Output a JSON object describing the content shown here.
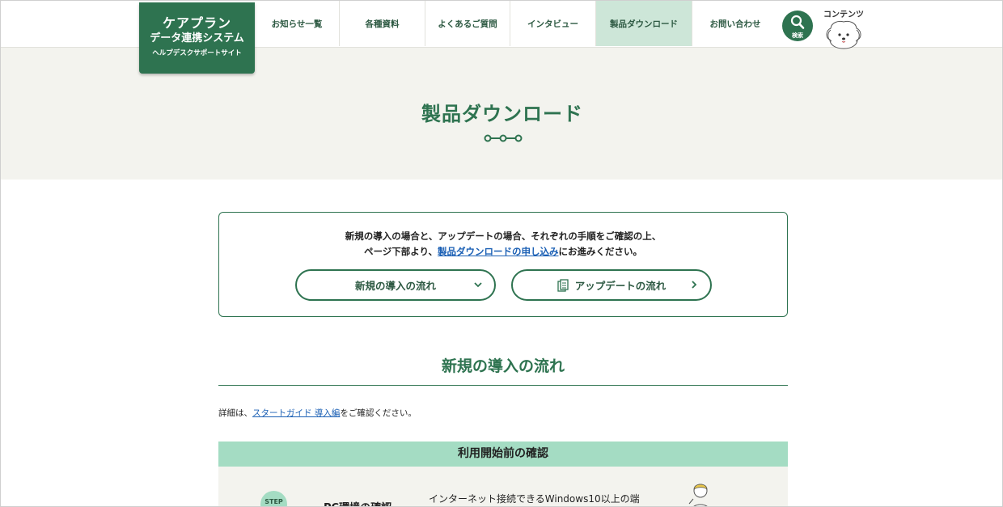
{
  "logo": {
    "line1": "ケアプラン",
    "line2": "データ連携システム",
    "line3": "ヘルプデスクサポートサイト"
  },
  "nav": [
    {
      "label": "お知らせ一覧",
      "active": false
    },
    {
      "label": "各種資料",
      "active": false
    },
    {
      "label": "よくあるご質問",
      "active": false
    },
    {
      "label": "インタビュー",
      "active": false
    },
    {
      "label": "製品ダウンロード",
      "active": true
    },
    {
      "label": "お問い合わせ",
      "active": false
    }
  ],
  "search": {
    "label": "検索"
  },
  "contents": {
    "label": "コンテンツ"
  },
  "hero": {
    "title": "製品ダウンロード"
  },
  "info": {
    "line1": "新規の導入の場合と、アップデートの場合、それぞれの手順をご確認の上、",
    "line2_prefix": "ページ下部より、",
    "line2_link": "製品ダウンロードの申し込み",
    "line2_suffix": "にお進みください。",
    "button_new": "新規の導入の流れ",
    "button_update": "アップデートの流れ"
  },
  "section": {
    "title": "新規の導入の流れ",
    "detail_prefix": "詳細は、",
    "detail_link": "スタートガイド 導入編",
    "detail_suffix": "をご確認ください。"
  },
  "band": {
    "title": "利用開始前の確認"
  },
  "step": {
    "badge": "STEP",
    "title": "PC環境の確認",
    "desc": "インターネット接続できるWindows10以上の端"
  },
  "colors": {
    "brand": "#2e7350",
    "nav_active_bg": "#cde6d8",
    "hero_bg": "#f3f3ee",
    "band_bg": "#a4dcc3",
    "link": "#1a5fb4"
  }
}
